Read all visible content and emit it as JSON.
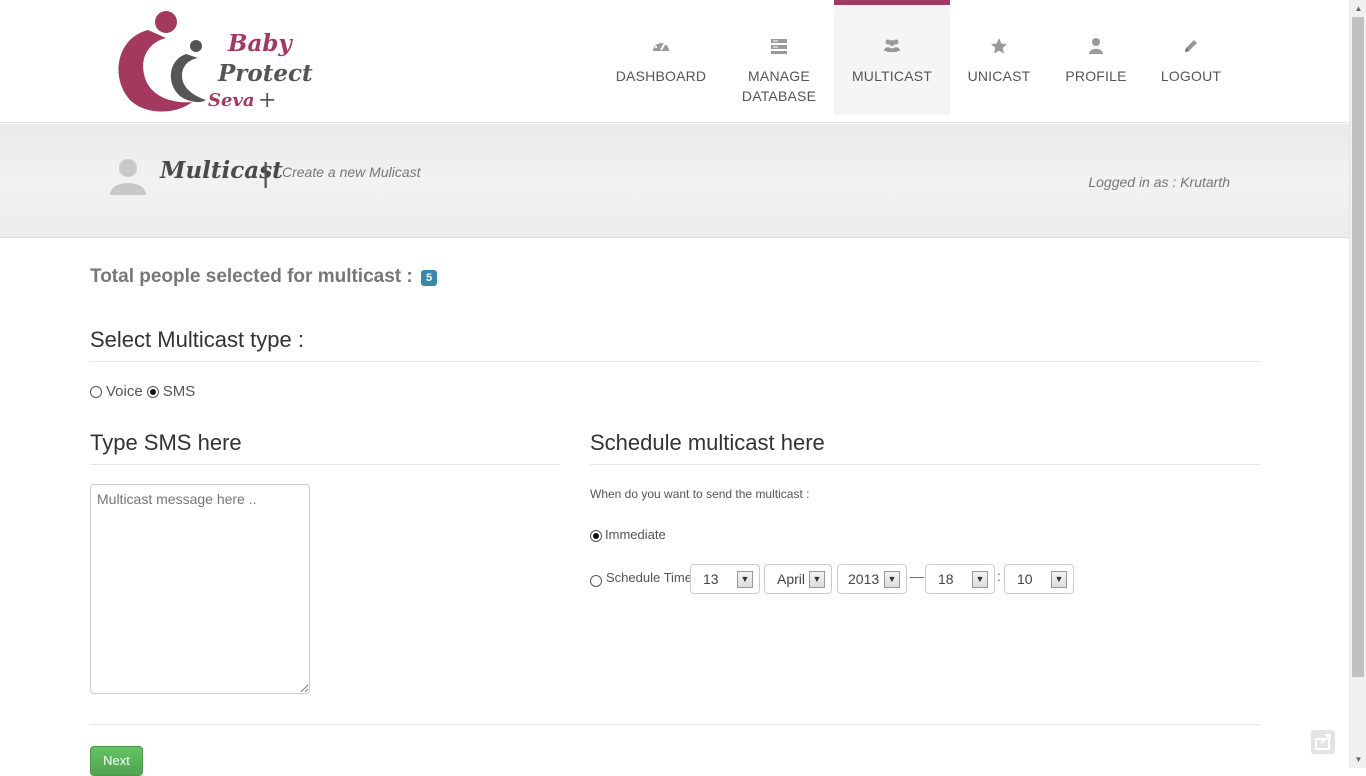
{
  "brand": {
    "line1": "Baby",
    "line2": "Protect",
    "line3": "Seva",
    "plus": "+"
  },
  "nav": {
    "items": [
      {
        "label": "DASHBOARD",
        "icon": "dashboard-icon"
      },
      {
        "label": "MANAGE\nDATABASE",
        "icon": "database-icon"
      },
      {
        "label": "MULTICAST",
        "icon": "group-icon",
        "active": true
      },
      {
        "label": "UNICAST",
        "icon": "star-icon"
      },
      {
        "label": "PROFILE",
        "icon": "user-icon"
      },
      {
        "label": "LOGOUT",
        "icon": "pencil-icon"
      }
    ],
    "active_color": "#9b3d62"
  },
  "header": {
    "title": "Multicast",
    "separator": "|",
    "subtitle": "Create a new Mulicast",
    "logged_in": "Logged in as : Krutarth"
  },
  "main": {
    "total_label": "Total people selected for multicast :",
    "total_count": "5",
    "type_heading": "Select Multicast type :",
    "type_options": [
      {
        "label": "Voice",
        "checked": false
      },
      {
        "label": "SMS",
        "checked": true
      }
    ],
    "sms_heading": "Type SMS here",
    "sms_placeholder": "Multicast message here ..",
    "schedule_heading": "Schedule multicast here",
    "when_label": "When do you want to send the multicast :",
    "immediate_label": "Immediate",
    "immediate_checked": true,
    "schedule_label": "Schedule Time",
    "schedule_checked": false,
    "day": "13",
    "month": "April",
    "year": "2013",
    "dash": "—",
    "hour": "18",
    "colon": ":",
    "minute": "10",
    "next_label": "Next"
  },
  "colors": {
    "badge": "#3a87ad",
    "next_button": "#5bb75b"
  }
}
